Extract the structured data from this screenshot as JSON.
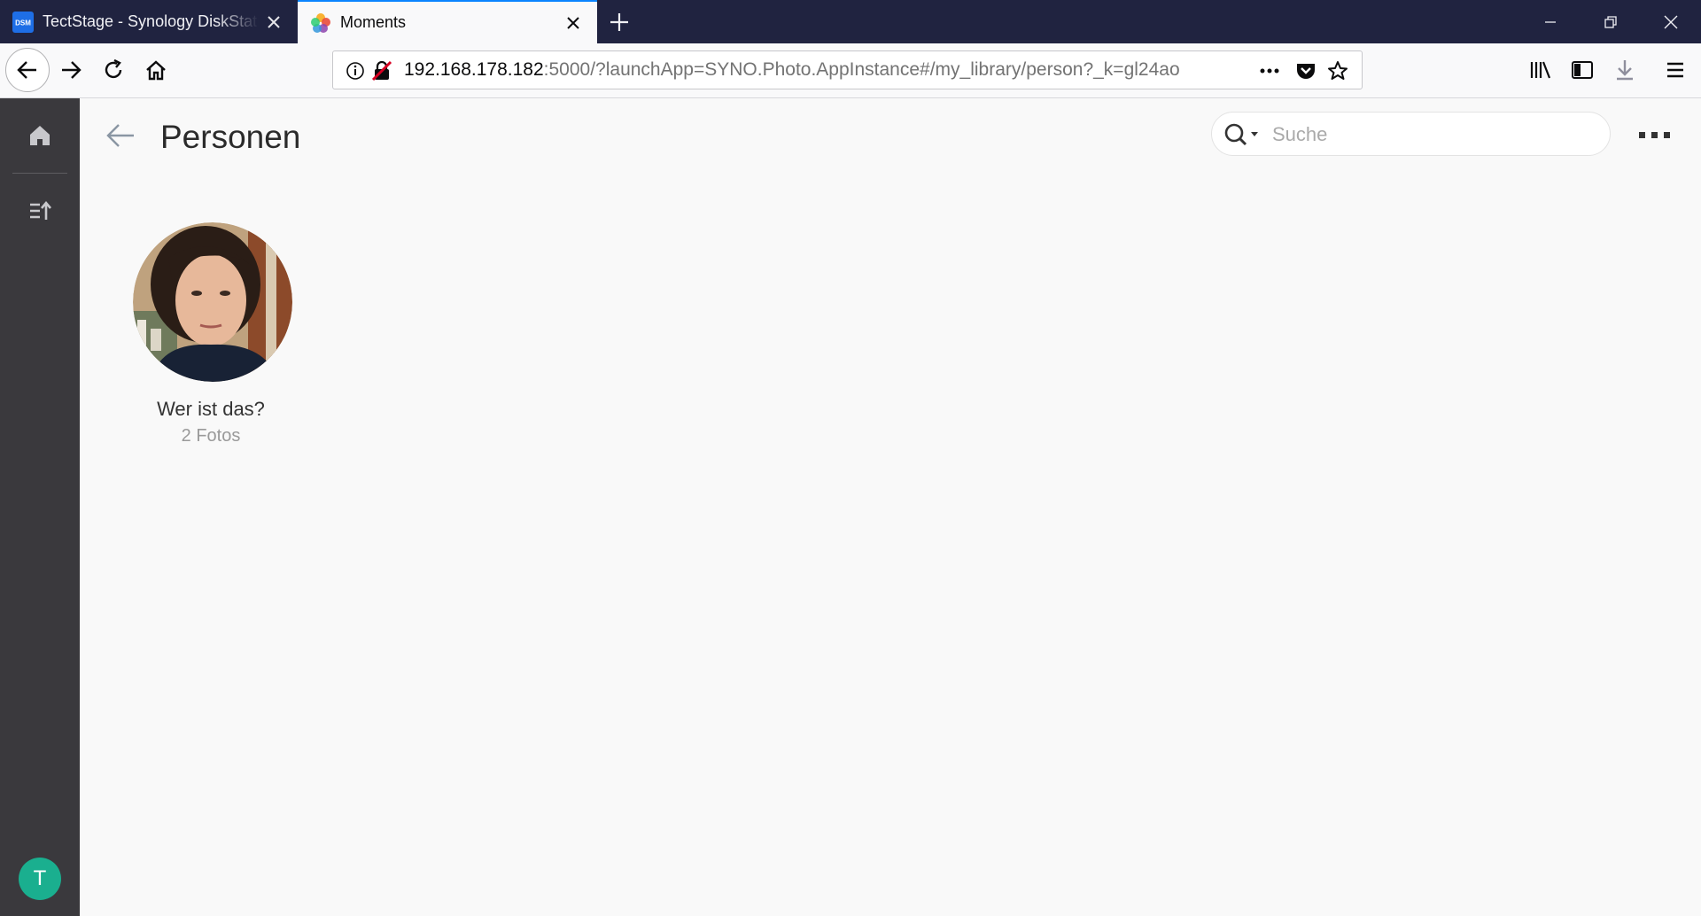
{
  "browser": {
    "tabs": [
      {
        "title": "TectStage - Synology DiskStation",
        "favicon_text": "DSM",
        "active": false
      },
      {
        "title": "Moments",
        "active": true
      }
    ],
    "url": {
      "host": "192.168.178.182",
      "rest": ":5000/?launchApp=SYNO.Photo.AppInstance#/my_library/person?_k=gl24ao"
    },
    "accent": "#0a84ff"
  },
  "sidebar": {
    "avatar_letter": "T",
    "avatar_color": "#1aaf8f"
  },
  "main": {
    "title": "Personen",
    "search": {
      "placeholder": "Suche"
    },
    "persons": [
      {
        "name": "Wer ist das?",
        "count": "2 Fotos"
      }
    ]
  }
}
